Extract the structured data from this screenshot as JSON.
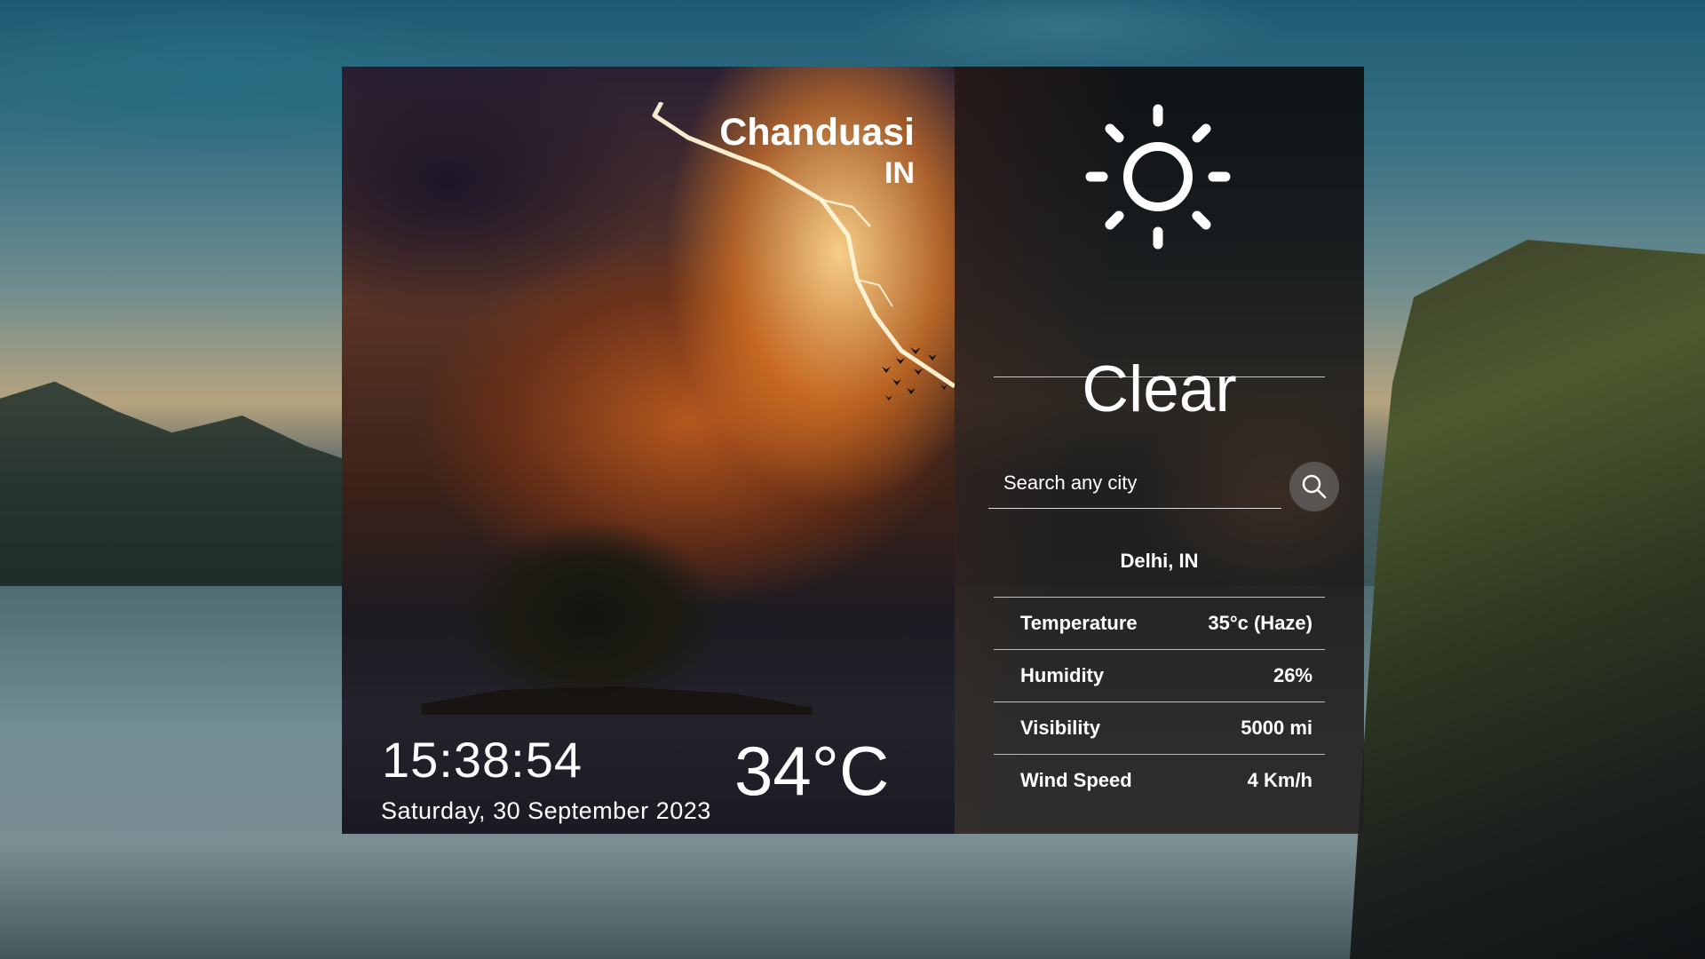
{
  "left": {
    "city": "Chanduasi",
    "country": "IN",
    "time": "15:38:54",
    "date": "Saturday, 30 September 2023",
    "temperature": "34°C"
  },
  "right": {
    "weather_icon": "sun-icon",
    "condition": "Clear",
    "search": {
      "placeholder": "Search any city",
      "button_icon": "search-icon"
    },
    "location": "Delhi, IN",
    "stats": [
      {
        "label": "Temperature",
        "value": "35°c (Haze)"
      },
      {
        "label": "Humidity",
        "value": "26%"
      },
      {
        "label": "Visibility",
        "value": "5000 mi"
      },
      {
        "label": "Wind Speed",
        "value": "4 Km/h"
      }
    ]
  },
  "colors": {
    "text": "#ffffff",
    "panel_overlay": "#141414"
  }
}
